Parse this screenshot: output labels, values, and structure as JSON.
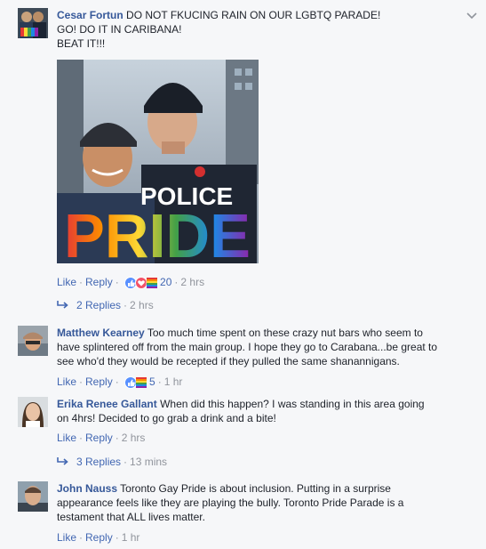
{
  "comments": [
    {
      "author": "Cesar Fortun",
      "lines": [
        "DO NOT FKUCING RAIN ON OUR LGBTQ PARADE!",
        "GO! DO IT IN CARIBANA!",
        "BEAT IT!!!"
      ],
      "image_text": {
        "police": "POLICE",
        "pride": "PRIDE"
      },
      "like_label": "Like",
      "reply_label": "Reply",
      "reaction_count": "20",
      "time": "2 hrs",
      "replies_label": "2 Replies",
      "replies_time": "2 hrs"
    },
    {
      "author": "Matthew Kearney",
      "lines": [
        "Too much time spent on these crazy nut bars who seem to",
        "have splintered off from the main group. I hope they go to Carabana...be great to",
        "see who'd they would be recepted if they pulled the same shanannigans."
      ],
      "like_label": "Like",
      "reply_label": "Reply",
      "reaction_count": "5",
      "time": "1 hr"
    },
    {
      "author": "Erika Renee Gallant",
      "lines": [
        "When did this happen? I was standing in this area going",
        "on 4hrs! Decided to go grab a drink and a bite!"
      ],
      "like_label": "Like",
      "reply_label": "Reply",
      "time": "2 hrs",
      "replies_label": "3 Replies",
      "replies_time": "13 mins"
    },
    {
      "author": "John Nauss",
      "lines": [
        "Toronto Gay Pride is about inclusion. Putting in a surprise",
        "appearance feels like they are playing the bully. Toronto Pride Parade is a",
        "testament that ALL lives matter."
      ],
      "like_label": "Like",
      "reply_label": "Reply",
      "time": "1 hr"
    }
  ],
  "colors": {
    "link": "#4267b2",
    "author": "#365899",
    "meta": "#90949c",
    "text": "#1d2129",
    "background": "#f6f7f9"
  },
  "icons": [
    "chevron-down-icon",
    "like-reaction-icon",
    "love-reaction-icon",
    "pride-reaction-icon",
    "reply-arrow-icon"
  ]
}
